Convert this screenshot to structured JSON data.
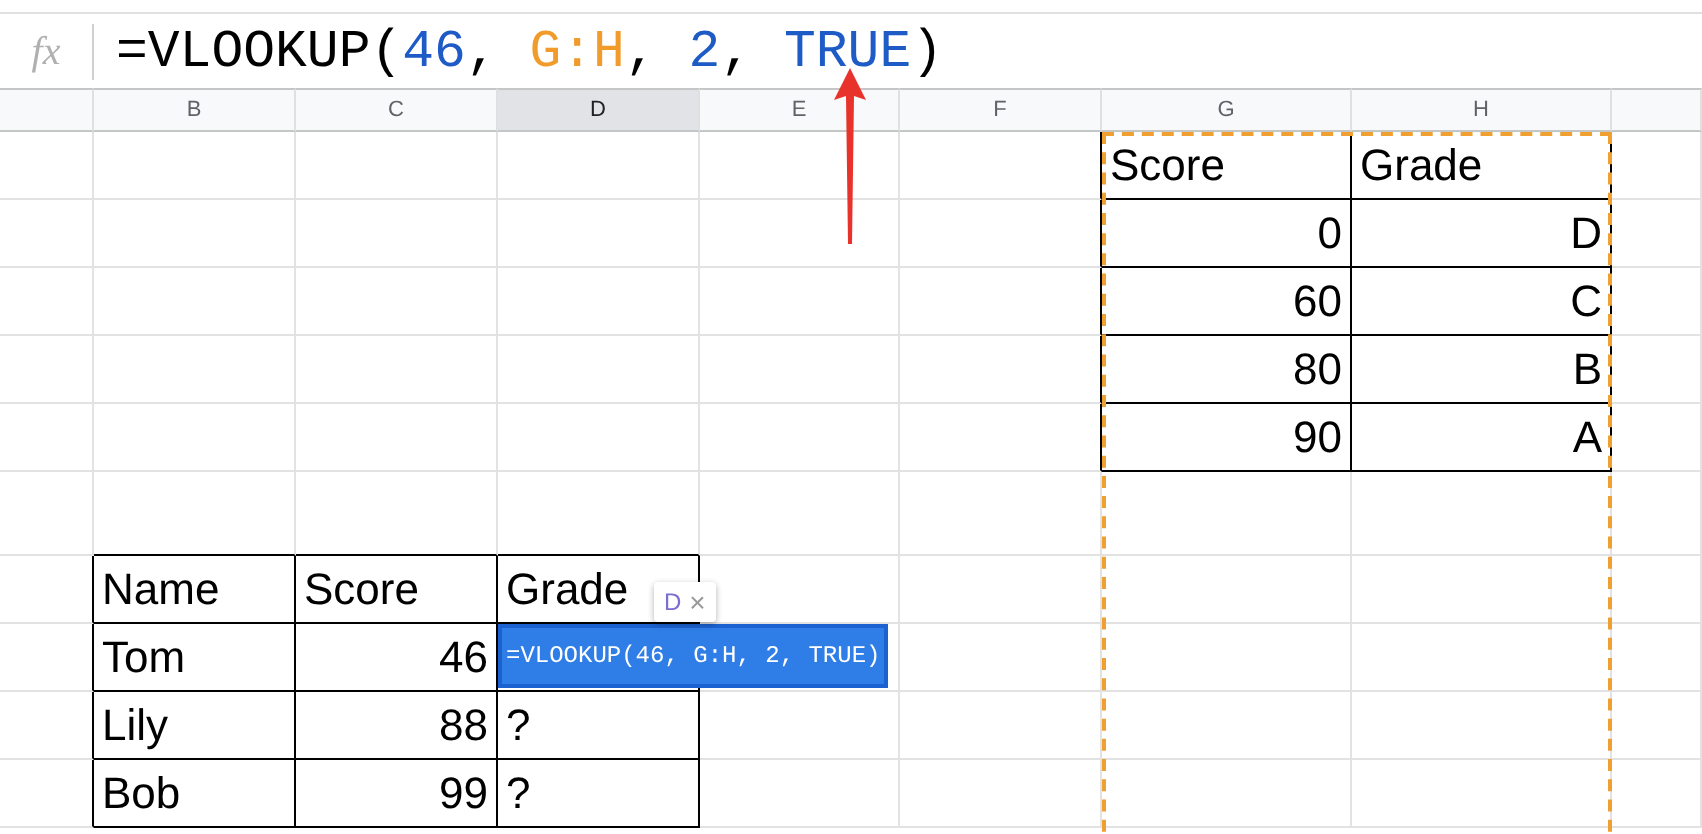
{
  "formula_bar": {
    "fx_label": "fx",
    "tokens": [
      {
        "text": "=VLOOKUP(",
        "kind": "plain"
      },
      {
        "text": "46",
        "kind": "number"
      },
      {
        "text": ", ",
        "kind": "plain"
      },
      {
        "text": "G:H",
        "kind": "range"
      },
      {
        "text": ", ",
        "kind": "plain"
      },
      {
        "text": "2",
        "kind": "number"
      },
      {
        "text": ", ",
        "kind": "plain"
      },
      {
        "text": "TRUE",
        "kind": "number"
      },
      {
        "text": ")",
        "kind": "plain"
      }
    ]
  },
  "columns": [
    {
      "label": "B",
      "selected": false
    },
    {
      "label": "C",
      "selected": false
    },
    {
      "label": "D",
      "selected": true
    },
    {
      "label": "E",
      "selected": false
    },
    {
      "label": "F",
      "selected": false
    },
    {
      "label": "G",
      "selected": false
    },
    {
      "label": "H",
      "selected": false
    }
  ],
  "lookup_table": {
    "header": [
      "Score",
      "Grade"
    ],
    "rows": [
      [
        "0",
        "D"
      ],
      [
        "60",
        "C"
      ],
      [
        "80",
        "B"
      ],
      [
        "90",
        "A"
      ]
    ]
  },
  "students_table": {
    "header": [
      "Name",
      "Score",
      "Grade"
    ],
    "rows": [
      [
        "Tom",
        "46",
        ""
      ],
      [
        "Lily",
        "88",
        "?"
      ],
      [
        "Bob",
        "99",
        "?"
      ]
    ]
  },
  "cell_editor": {
    "text": "=VLOOKUP(46, G:H, 2, TRUE)",
    "hint": "D",
    "close": "×"
  }
}
